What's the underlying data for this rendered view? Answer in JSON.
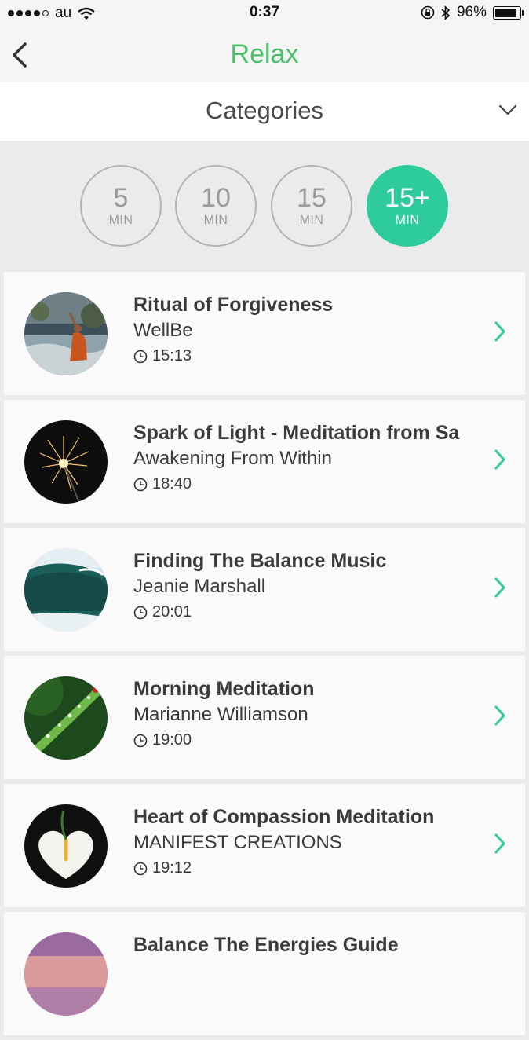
{
  "status_bar": {
    "carrier": "au",
    "time": "0:37",
    "battery": "96%",
    "battery_level": 0.96
  },
  "nav": {
    "title": "Relax",
    "back_icon": "chevron-left-icon",
    "title_color": "#4cbf6c"
  },
  "categories": {
    "label": "Categories",
    "icon": "chevron-down-icon"
  },
  "durations": [
    {
      "num": "5",
      "unit": "MIN",
      "active": false
    },
    {
      "num": "10",
      "unit": "MIN",
      "active": false
    },
    {
      "num": "15",
      "unit": "MIN",
      "active": false
    },
    {
      "num": "15+",
      "unit": "MIN",
      "active": true
    }
  ],
  "accent_color": "#2ecb9c",
  "tracks": [
    {
      "title": "Ritual of Forgiveness",
      "author": "WellBe",
      "duration": "15:13",
      "image": "monk-by-river"
    },
    {
      "title": "Spark of Light - Meditation from Sa",
      "author": "Awakening From Within",
      "duration": "18:40",
      "image": "sparkler"
    },
    {
      "title": "Finding The Balance Music",
      "author": "Jeanie Marshall",
      "duration": "20:01",
      "image": "ocean-wave"
    },
    {
      "title": "Morning Meditation",
      "author": "Marianne Williamson",
      "duration": "19:00",
      "image": "dewy-grass-ladybug"
    },
    {
      "title": "Heart of Compassion Meditation",
      "author": "MANIFEST CREATIONS",
      "duration": "19:12",
      "image": "white-calla-lily"
    },
    {
      "title": "Balance The Energies Guide",
      "author": "",
      "duration": "",
      "image": "sunset-sky"
    }
  ]
}
